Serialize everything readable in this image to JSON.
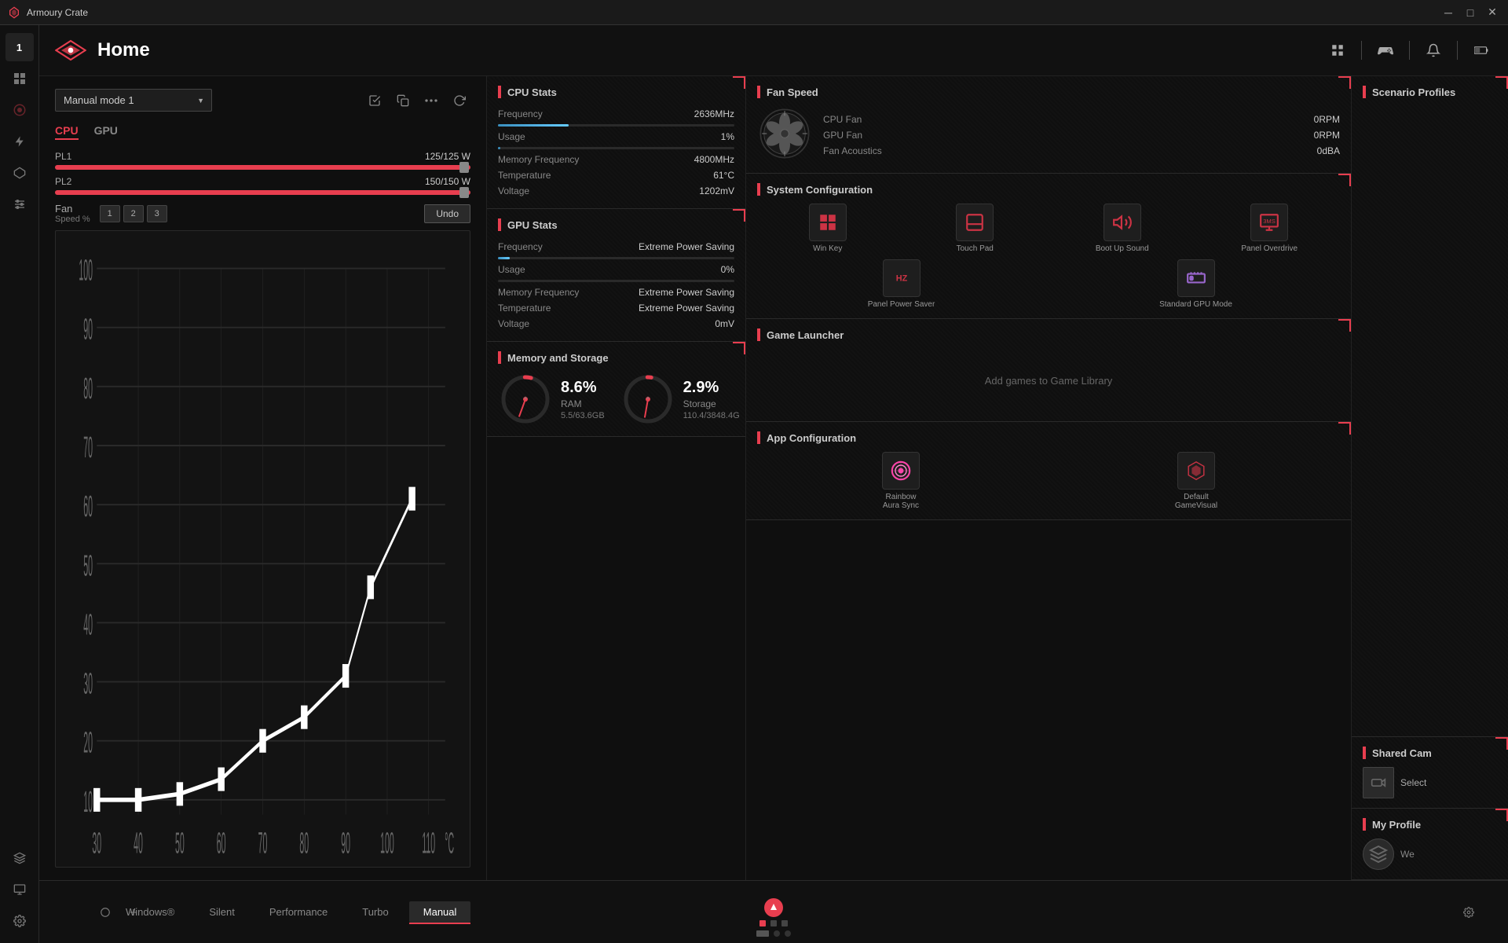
{
  "titlebar": {
    "title": "Armoury Crate",
    "minimize": "─",
    "maximize": "□",
    "close": "✕"
  },
  "header": {
    "title": "Home"
  },
  "sidebar": {
    "items": [
      {
        "id": "number",
        "icon": "1",
        "label": "number badge"
      },
      {
        "id": "grid",
        "icon": "⊞",
        "label": "grid view"
      },
      {
        "id": "profile",
        "icon": "◎",
        "label": "profile circle"
      },
      {
        "id": "lightning",
        "icon": "⚡",
        "label": "performance"
      },
      {
        "id": "aura",
        "icon": "◈",
        "label": "aura sync"
      },
      {
        "id": "wrench",
        "icon": "⚙",
        "label": "settings group"
      },
      {
        "id": "settings2",
        "icon": "⚙",
        "label": "settings"
      },
      {
        "id": "tag",
        "icon": "✦",
        "label": "tag"
      },
      {
        "id": "display",
        "icon": "▣",
        "label": "display"
      }
    ]
  },
  "header_icons": [
    {
      "id": "grid-view",
      "icon": "⊞"
    },
    {
      "id": "gamepad",
      "icon": "🎮"
    },
    {
      "id": "bell",
      "icon": "🔔"
    },
    {
      "id": "battery",
      "icon": "🔋"
    }
  ],
  "mode": {
    "current": "Manual mode 1",
    "options": [
      "Manual mode 1",
      "Silent",
      "Performance",
      "Turbo",
      "Windows"
    ]
  },
  "cpu_gpu_tabs": {
    "active": "CPU",
    "tabs": [
      "CPU",
      "GPU"
    ]
  },
  "power": {
    "pl1": {
      "label": "PL1",
      "value": "125/125 W",
      "percent": 100
    },
    "pl2": {
      "label": "PL2",
      "value": "150/150 W",
      "percent": 100
    }
  },
  "fan": {
    "label": "Fan",
    "speed_label": "Speed %",
    "presets": [
      "1",
      "2",
      "3"
    ],
    "undo_label": "Undo",
    "x_axis_label": "°C",
    "x_ticks": [
      "30",
      "40",
      "50",
      "60",
      "70",
      "80",
      "90",
      "100",
      "110"
    ],
    "y_ticks": [
      "10",
      "20",
      "30",
      "40",
      "50",
      "60",
      "70",
      "80",
      "90",
      "100"
    ],
    "points": [
      [
        120,
        460
      ],
      [
        165,
        460
      ],
      [
        210,
        455
      ],
      [
        250,
        445
      ],
      [
        290,
        430
      ],
      [
        315,
        415
      ],
      [
        350,
        390
      ],
      [
        360,
        330
      ],
      [
        400,
        260
      ]
    ]
  },
  "cpu_stats": {
    "title": "CPU Stats",
    "frequency": {
      "label": "Frequency",
      "value": "2636MHz"
    },
    "bar_percent": 30,
    "usage": {
      "label": "Usage",
      "value": "1%"
    },
    "usage_percent": 1,
    "memory_frequency": {
      "label": "Memory Frequency",
      "value": "4800MHz"
    },
    "temperature": {
      "label": "Temperature",
      "value": "61°C"
    },
    "voltage": {
      "label": "Voltage",
      "value": "1202mV"
    }
  },
  "gpu_stats": {
    "title": "GPU Stats",
    "frequency": {
      "label": "Frequency",
      "value": "Extreme Power Saving"
    },
    "bar_percent": 5,
    "usage": {
      "label": "Usage",
      "value": "0%"
    },
    "usage_percent": 0,
    "memory_frequency": {
      "label": "Memory Frequency",
      "value": "Extreme Power Saving"
    },
    "temperature": {
      "label": "Temperature",
      "value": "Extreme Power Saving"
    },
    "voltage": {
      "label": "Voltage",
      "value": "0mV"
    }
  },
  "fan_speed": {
    "title": "Fan Speed",
    "cpu_fan": {
      "label": "CPU Fan",
      "value": "0RPM"
    },
    "gpu_fan": {
      "label": "GPU Fan",
      "value": "0RPM"
    },
    "fan_acoustics": {
      "label": "Fan Acoustics",
      "value": "0dBA"
    }
  },
  "system_config": {
    "title": "System Configuration",
    "items": [
      {
        "id": "win-key",
        "icon": "⊞",
        "label": "Win Key"
      },
      {
        "id": "touch-pad",
        "icon": "⬜",
        "label": "Touch Pad"
      },
      {
        "id": "boot-sound",
        "icon": "🔊",
        "label": "Boot Up Sound"
      },
      {
        "id": "panel-overdrive",
        "icon": "📺",
        "label": "Panel Overdrive"
      },
      {
        "id": "panel-power-saver",
        "icon": "🔋",
        "label": "Panel Power Saver"
      },
      {
        "id": "standard-gpu",
        "icon": "🖥",
        "label": "Standard GPU Mode"
      }
    ]
  },
  "game_launcher": {
    "title": "Game Launcher",
    "empty_text": "Add games to Game Library"
  },
  "memory_storage": {
    "title": "Memory and Storage",
    "ram": {
      "percent": "8.6%",
      "label": "RAM",
      "detail": "5.5/63.6GB",
      "gauge_percent": 8.6
    },
    "storage": {
      "percent": "2.9%",
      "label": "Storage",
      "detail": "110.4/3848.4G",
      "gauge_percent": 2.9
    }
  },
  "app_config": {
    "title": "App Configuration",
    "items": [
      {
        "id": "rainbow-aura",
        "label": "Rainbow\nAura Sync",
        "color": "rainbow"
      },
      {
        "id": "default-gamevisual",
        "label": "Default\nGameVisual",
        "color": "default"
      }
    ]
  },
  "scenario_profiles": {
    "title": "Scenario Profiles"
  },
  "shared_cam": {
    "title": "Shared Cam",
    "select_label": "Select"
  },
  "my_profile": {
    "title": "My Profile",
    "welcome": "We"
  },
  "bottom_bar": {
    "modes": [
      {
        "id": "windows",
        "label": "Windows®",
        "active": false
      },
      {
        "id": "silent",
        "label": "Silent",
        "active": false
      },
      {
        "id": "performance",
        "label": "Performance",
        "active": false
      },
      {
        "id": "turbo",
        "label": "Turbo",
        "active": false
      },
      {
        "id": "manual",
        "label": "Manual",
        "active": true
      }
    ]
  }
}
